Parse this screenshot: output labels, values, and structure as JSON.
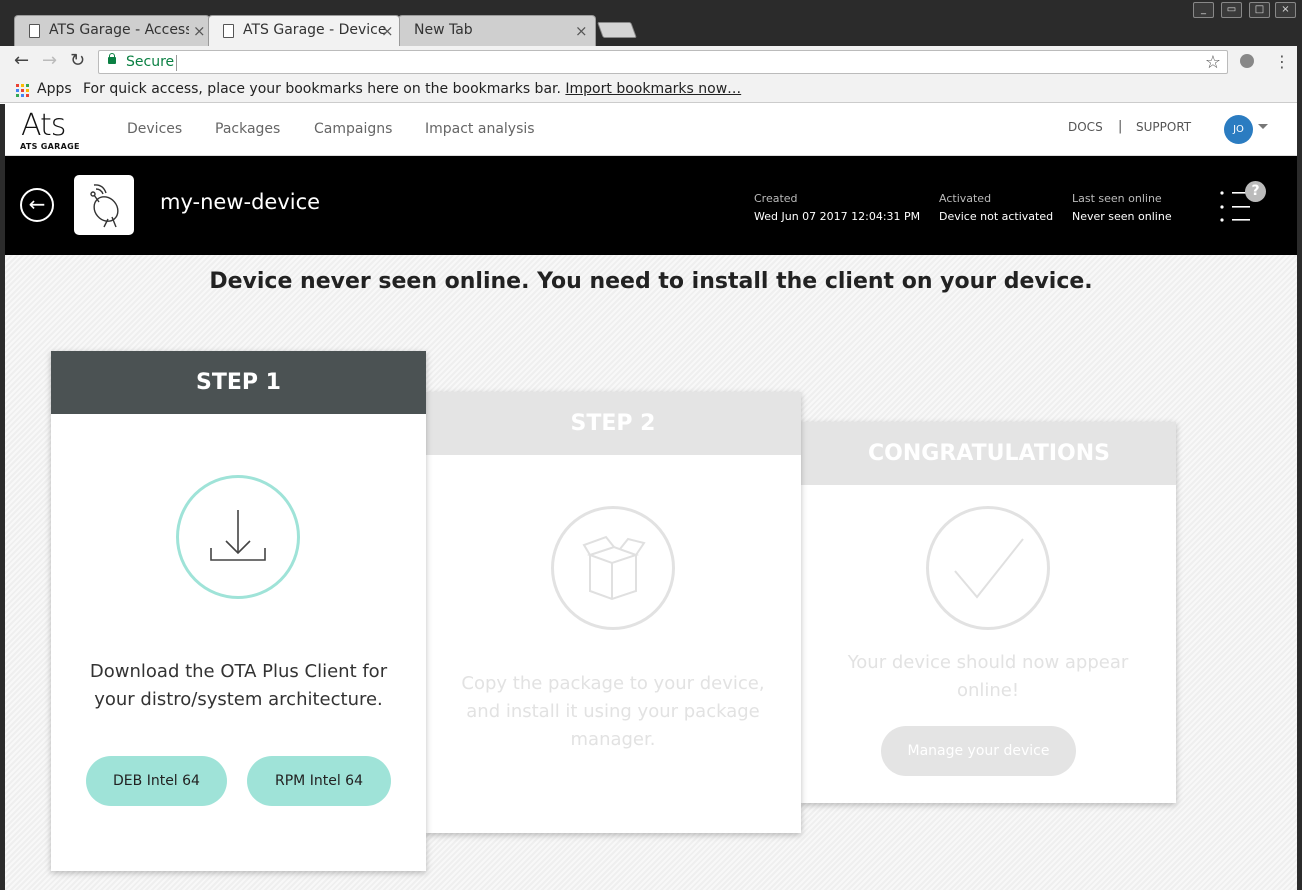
{
  "browser": {
    "tabs": [
      {
        "title": "ATS Garage - Access",
        "close": "×"
      },
      {
        "title": "ATS Garage - Device",
        "close": "×"
      },
      {
        "title": "New Tab",
        "close": "×"
      }
    ],
    "secure_label": "Secure",
    "apps_label": "Apps",
    "bookmarks_prompt": "For quick access, place your bookmarks here on the bookmarks bar.",
    "import_link": "Import bookmarks now…"
  },
  "header": {
    "logo": "Ats",
    "logo_sub": "ATS GARAGE",
    "nav": [
      "Devices",
      "Packages",
      "Campaigns",
      "Impact analysis"
    ],
    "docs": "DOCS",
    "separator": "|",
    "support": "SUPPORT",
    "avatar_initials": "JO"
  },
  "device": {
    "name": "my-new-device",
    "created_label": "Created",
    "created_value": "Wed Jun 07 2017 12:04:31 PM",
    "activated_label": "Activated",
    "activated_value": "Device not activated",
    "last_seen_label": "Last seen online",
    "last_seen_value": "Never seen online",
    "help": "?"
  },
  "main": {
    "headline": "Device never seen online. You need to install the client on your device.",
    "step1": {
      "title": "STEP 1",
      "text_line1": "Download the OTA Plus Client for",
      "text_line2": "your distro/system architecture.",
      "deb_button": "DEB Intel 64",
      "rpm_button": "RPM Intel 64"
    },
    "step2": {
      "title": "STEP 2",
      "text_line1": "Copy the package to your device,",
      "text_line2": "and install it using your package",
      "text_line3": "manager."
    },
    "step3": {
      "title": "CONGRATULATIONS",
      "text_line1": "Your device should now appear",
      "text_line2": "online!",
      "button": "Manage your device"
    }
  },
  "colors": {
    "accent_teal": "#9fe3d8",
    "step1_header": "#4b5253",
    "disabled_header": "#e4e4e4",
    "avatar": "#2b7cc1"
  }
}
